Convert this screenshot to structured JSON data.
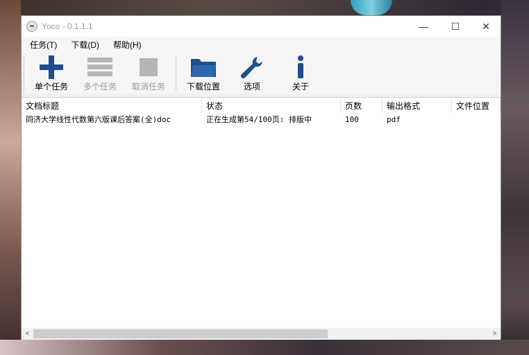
{
  "window": {
    "title": "Yoco - 0.1.1.1",
    "controls": {
      "minimize": "—",
      "maximize": "☐",
      "close": "✕"
    }
  },
  "menu": [
    "任务(T)",
    "下载(D)",
    "帮助(H)"
  ],
  "toolbar": {
    "items": [
      {
        "label": "单个任务",
        "icon": "plus-icon",
        "enabled": true
      },
      {
        "label": "多个任务",
        "icon": "list-icon",
        "enabled": false
      },
      {
        "label": "取消任务",
        "icon": "stop-icon",
        "enabled": false
      },
      {
        "label": "下载位置",
        "icon": "folder-icon",
        "enabled": true
      },
      {
        "label": "选项",
        "icon": "wrench-icon",
        "enabled": true
      },
      {
        "label": "关于",
        "icon": "info-icon",
        "enabled": true
      }
    ],
    "icon_color": "#1f4e8c",
    "disabled_color": "#b5b5b5"
  },
  "table": {
    "columns": [
      "文档标题",
      "状态",
      "页数",
      "输出格式",
      "文件位置"
    ],
    "rows": [
      [
        "同济大学线性代数第六版课后答案(全)doc",
        "正在生成第54/100页: 排版中",
        "100",
        "pdf",
        ""
      ]
    ]
  },
  "scrollbar": {
    "left_arrow": "<",
    "right_arrow": ">"
  }
}
